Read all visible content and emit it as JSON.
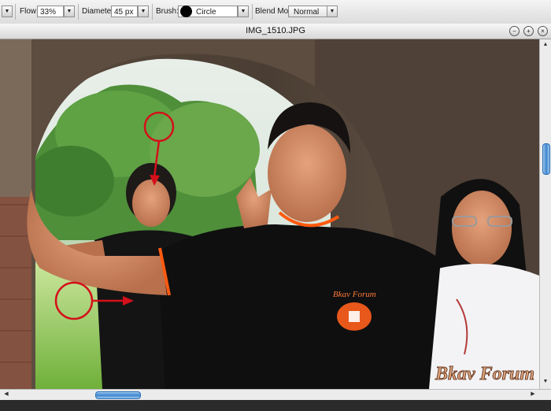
{
  "toolbar": {
    "flow_label": "Flow:",
    "flow_value": "33%",
    "diameter_label": "Diameter:",
    "diameter_value": "45 px",
    "brush_label": "Brush:",
    "brush_value": "Circle",
    "blend_label": "Blend Mode:",
    "blend_value": "Normal",
    "dropdown_glyph": "▼"
  },
  "window": {
    "title": "IMG_1510.JPG",
    "minimize_glyph": "−",
    "maximize_glyph": "+",
    "close_glyph": "×"
  },
  "image": {
    "shirt_logo_text": "Bkav Forum",
    "watermark_text": "Bkav Forum"
  },
  "scrollbars": {
    "up_glyph": "▲",
    "down_glyph": "▼",
    "left_glyph": "◀",
    "right_glyph": "▶"
  },
  "colors": {
    "annotation_red": "#d4101a",
    "scroll_blue": "#3f86cf",
    "shirt_orange": "#ff5a10"
  }
}
